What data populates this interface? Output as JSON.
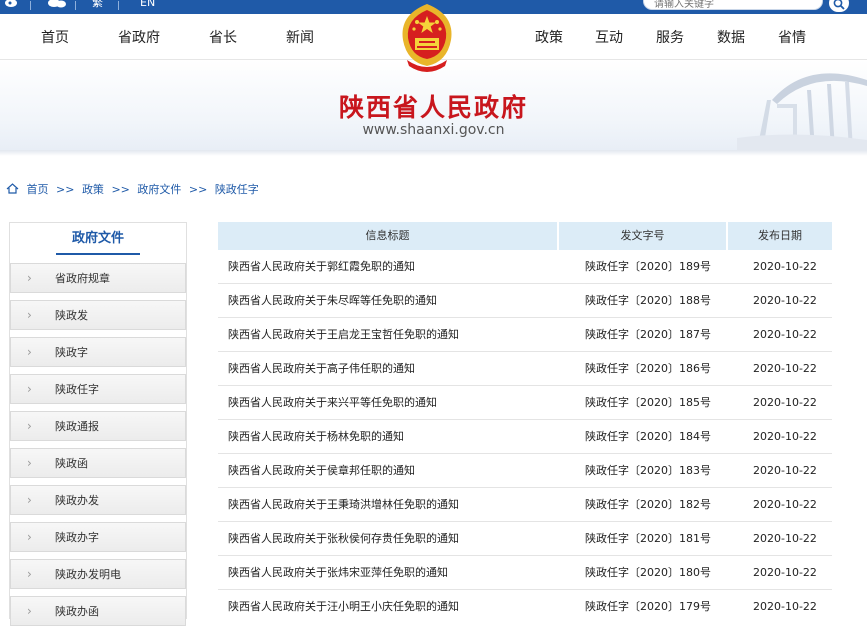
{
  "topbar": {
    "icons": [
      "weibo-icon",
      "wechat-icon"
    ],
    "links": [
      {
        "label": "繁"
      },
      {
        "label": "EN"
      }
    ],
    "search_placeholder": "请输入关键字"
  },
  "nav": {
    "left": [
      "首页",
      "省政府",
      "省长",
      "新闻"
    ],
    "right": [
      "政策",
      "互动",
      "服务",
      "数据",
      "省情"
    ]
  },
  "banner": {
    "title": "陕西省人民政府",
    "url": "www.shaanxi.gov.cn"
  },
  "breadcrumb": {
    "items": [
      "首页",
      "政策",
      "政府文件",
      "陕政任字"
    ],
    "separator": ">>"
  },
  "sidebar": {
    "title": "政府文件",
    "items": [
      "省政府规章",
      "陕政发",
      "陕政字",
      "陕政任字",
      "陕政通报",
      "陕政函",
      "陕政办发",
      "陕政办字",
      "陕政办发明电",
      "陕政办函"
    ]
  },
  "table": {
    "headers": [
      "信息标题",
      "发文字号",
      "发布日期"
    ],
    "rows": [
      {
        "title": "陕西省人民政府关于郭红霞免职的通知",
        "number": "陕政任字〔2020〕189号",
        "date": "2020-10-22"
      },
      {
        "title": "陕西省人民政府关于朱尽晖等任免职的通知",
        "number": "陕政任字〔2020〕188号",
        "date": "2020-10-22"
      },
      {
        "title": "陕西省人民政府关于王启龙王宝哲任免职的通知",
        "number": "陕政任字〔2020〕187号",
        "date": "2020-10-22"
      },
      {
        "title": "陕西省人民政府关于高子伟任职的通知",
        "number": "陕政任字〔2020〕186号",
        "date": "2020-10-22"
      },
      {
        "title": "陕西省人民政府关于来兴平等任免职的通知",
        "number": "陕政任字〔2020〕185号",
        "date": "2020-10-22"
      },
      {
        "title": "陕西省人民政府关于杨林免职的通知",
        "number": "陕政任字〔2020〕184号",
        "date": "2020-10-22"
      },
      {
        "title": "陕西省人民政府关于侯章邦任职的通知",
        "number": "陕政任字〔2020〕183号",
        "date": "2020-10-22"
      },
      {
        "title": "陕西省人民政府关于王秉琦洪增林任免职的通知",
        "number": "陕政任字〔2020〕182号",
        "date": "2020-10-22"
      },
      {
        "title": "陕西省人民政府关于张秋侯何存贵任免职的通知",
        "number": "陕政任字〔2020〕181号",
        "date": "2020-10-22"
      },
      {
        "title": "陕西省人民政府关于张炜宋亚萍任免职的通知",
        "number": "陕政任字〔2020〕180号",
        "date": "2020-10-22"
      },
      {
        "title": "陕西省人民政府关于汪小明王小庆任免职的通知",
        "number": "陕政任字〔2020〕179号",
        "date": "2020-10-22"
      }
    ]
  },
  "colors": {
    "brand_blue": "#1f5aa8",
    "brand_red": "#c8161d",
    "header_bg": "#dcecf7"
  }
}
